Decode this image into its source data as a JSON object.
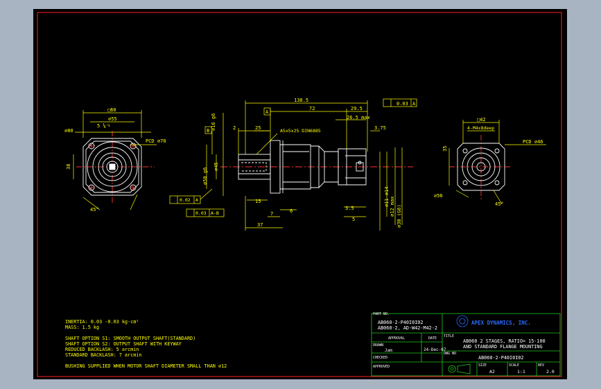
{
  "colors": {
    "border": "#ff2020",
    "dimension": "#ffff00",
    "outline": "#ffffff",
    "centerline": "#ff3030",
    "titleblock": "#22c822",
    "background": "#000000"
  },
  "dims": {
    "sq60": "□60",
    "d55": "⌀55",
    "d80": "⌀80",
    "m5": "5 ⅛ㄱ",
    "pcd70": "PCD ⌀70",
    "d38": "38",
    "a45": "45°",
    "total": "138.5",
    "datumA": "A",
    "d72": "72",
    "d295": "29.5",
    "tol003": "0.03",
    "tolA": "A",
    "d265": "26.5 max",
    "d375": "3.75",
    "d2": "2",
    "d25": "25",
    "key": "A5x5x25 DIN6885",
    "d16": "⌀16 g6",
    "d50": "⌀50 g6",
    "d45": "⌀45",
    "d15": "15",
    "d7": "7",
    "d6": "6",
    "d37": "37",
    "d35": "3.5",
    "d5": "5",
    "d11": "⌀11 ⌀14",
    "d12": "⌀12 max",
    "d30": "⌀30 (G6)",
    "tol002": "0.02",
    "tolA2": "A",
    "tol003b": "0.03",
    "tolAB": "A-B",
    "datumB": "B",
    "sq42": "□42",
    "m4": "4-M4x8deep",
    "pcd46": "PCD ⌀46",
    "d56": "⌀56",
    "d35r": "35",
    "a45r": "45°"
  },
  "notes": [
    "INERTIA:   0.03  -0.03 kg-cm²",
    "MASS:  1.5 kg",
    "",
    "SHAFT OPTION S1: SMOOTH OUTPUT SHAFT(STANDARD)",
    "SHAFT OPTION S2: OUTPUT SHAFT WITH KEYWAY",
    "REDUCED BACKLASH: 5 arcmin",
    "STANDARD BACKLASH: 7 arcmin",
    "",
    "BUSHING SUPPLIED WHEN MOTOR SHAFT DIAMETER SMALL THAN ⌀12"
  ],
  "titleblock": {
    "part_no_label": "PART NO.",
    "part_no_1": "AB060-2-P40I0I02",
    "part_no_2": "AB060-2, AD-W42-M42-2",
    "company": "APEX DYNAMICS, INC.",
    "approval_label": "APPROVAL",
    "date_label": "DATE",
    "title_label": "TITLE",
    "title_1": "AB060 2 STAGES, RATIO= 15-100",
    "title_2": "AND STANDARD FLANGE MOUNTING",
    "drawn_label": "DRAWN",
    "drawn_by": "Jam",
    "drawn_date": "24-Dec-07",
    "dwg_label": "DWG NO",
    "dwg_no": "AB060-2-P40I0I02",
    "checked_label": "CHECKED",
    "approved_label": "APPROVED",
    "size_label": "SIZE",
    "size": "A2",
    "scale_label": "SCALE",
    "scale": "1:1",
    "rev_label": "REV",
    "rev": "2.0"
  }
}
